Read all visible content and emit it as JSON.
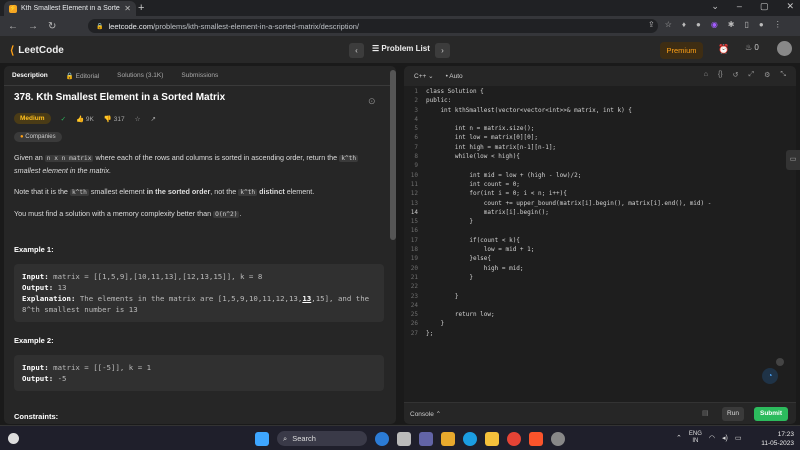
{
  "browser": {
    "tab_title": "Kth Smallest Element in a Sorte",
    "url_host": "leetcode.com",
    "url_path": "/problems/kth-smallest-element-in-a-sorted-matrix/description/"
  },
  "header": {
    "logo": "LeetCode",
    "problem_list": "Problem List",
    "premium": "Premium",
    "streak": "0"
  },
  "left_tabs": [
    "Description",
    "Editorial",
    "Solutions (3.1K)",
    "Submissions"
  ],
  "problem": {
    "title": "378. Kth Smallest Element in a Sorted Matrix",
    "difficulty": "Medium",
    "likes": "9K",
    "dislikes": "317",
    "companies": "Companies",
    "p1_a": "Given an ",
    "p1_code": "n x n matrix",
    "p1_b": " where each of the rows and columns is sorted in ascending order, return the ",
    "p1_code2": "k^th",
    "p1_c": " smallest element in the matrix.",
    "p2_a": "Note that it is the ",
    "p2_code": "k^th",
    "p2_b": " smallest element ",
    "p2_bold": "in the sorted order",
    "p2_c": ", not the ",
    "p2_code2": "k^th",
    "p2_bold2": " distinct",
    "p2_d": " element.",
    "p3_a": "You must find a solution with a memory complexity better than ",
    "p3_code": "O(n^2)",
    "p3_b": ".",
    "ex1_title": "Example 1:",
    "ex1_input": "matrix = [[1,5,9],[10,11,13],[12,13,15]], k = 8",
    "ex1_output": "13",
    "ex1_expl_a": "The elements in the matrix are [1,5,9,10,11,12,13,",
    "ex1_expl_bold": "13",
    "ex1_expl_b": ",15], and the",
    "ex1_expl_c": "8^th smallest number is 13",
    "ex2_title": "Example 2:",
    "ex2_input": "matrix = [[-5]], k = 1",
    "ex2_output": "-5",
    "constraints": "Constraints:",
    "lbl_input": "Input:",
    "lbl_output": "Output:",
    "lbl_expl": "Explanation:"
  },
  "editor": {
    "language": "C++",
    "mode": "Auto",
    "console": "Console",
    "run": "Run",
    "submit": "Submit",
    "lines": [
      "class Solution {",
      "public:",
      "    int kthSmallest(vector<vector<int>>& matrix, int k) {",
      "",
      "        int n = matrix.size();",
      "        int low = matrix[0][0];",
      "        int high = matrix[n-1][n-1];",
      "        while(low < high){",
      "",
      "            int mid = low + (high - low)/2;",
      "            int count = 0;",
      "            for(int i = 0; i < n; i++){",
      "                count += upper_bound(matrix[i].begin(), matrix[i].end(), mid) -",
      "                matrix[i].begin();",
      "            }",
      "",
      "            if(count < k){",
      "                low = mid + 1;",
      "            }else{",
      "                high = mid;",
      "            }",
      "",
      "        }",
      "",
      "        return low;",
      "    }",
      "};"
    ]
  },
  "taskbar": {
    "search": "Search",
    "lang1": "ENG",
    "lang2": "IN",
    "time": "17:23",
    "date": "11-05-2023"
  }
}
